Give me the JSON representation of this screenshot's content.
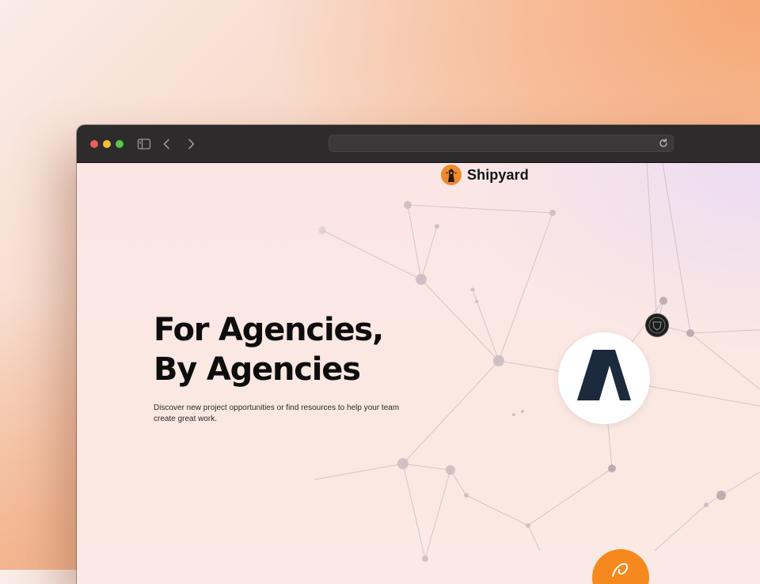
{
  "browser": {
    "url": "",
    "traffic_lights": [
      "#ee5f57",
      "#f4bd3d",
      "#5ec544"
    ]
  },
  "page": {
    "brand": {
      "name": "Shipyard",
      "logo_color": "#f08a2c"
    },
    "hero": {
      "headline_line1": "For Agencies,",
      "headline_line2": "By Agencies",
      "subtext": "Discover new project opportunities or find resources to help your team create great work."
    },
    "partner_logos": [
      {
        "icon": "caret-a-logo-icon",
        "color": "#1b2a3c"
      },
      {
        "icon": "crest-logo-icon",
        "color": "#1c1c1c"
      },
      {
        "icon": "script-logo-icon",
        "color": "#f5891e"
      }
    ]
  }
}
